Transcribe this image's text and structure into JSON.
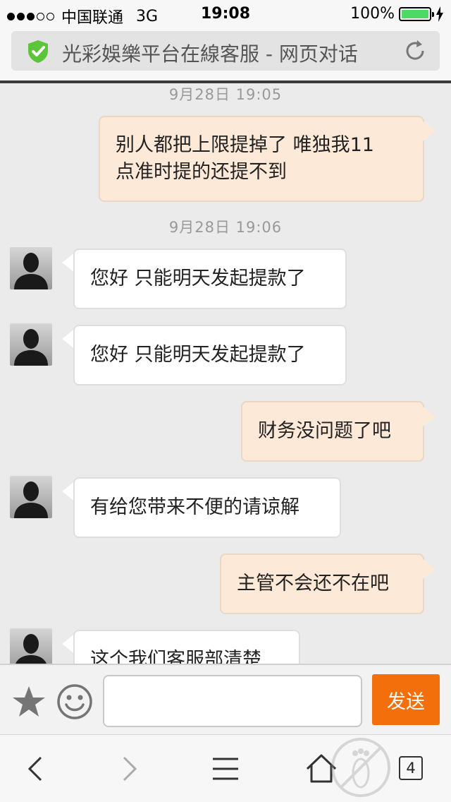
{
  "status_bar": {
    "carrier": "中国联通",
    "network": "3G",
    "time": "19:08",
    "battery": "100%",
    "signal_dots_filled": 3,
    "signal_dots_total": 5
  },
  "address_bar": {
    "title": "光彩娛樂平台在線客服 - 网页对话",
    "secure_icon": "shield-check-icon",
    "secure_color": "#5cc63a",
    "refresh_icon": "refresh-icon"
  },
  "messages": {
    "ts1": "9月28日 19:05",
    "m1_line1": "别人都把上限提掉了 唯独我11",
    "m1_line2": "点准时提的还提不到",
    "ts2": "9月28日 19:06",
    "m2": "您好 只能明天发起提款了",
    "m3": "您好 只能明天发起提款了",
    "m4": "财务没问题了吧",
    "m5": "有给您带来不便的请谅解",
    "m6": "主管不会还不在吧",
    "m7": "这个我们客服部清楚"
  },
  "input_bar": {
    "placeholder": "",
    "send_label": "发送",
    "send_color": "#f26f0c"
  },
  "toolbar": {
    "tabs_count": "4"
  }
}
